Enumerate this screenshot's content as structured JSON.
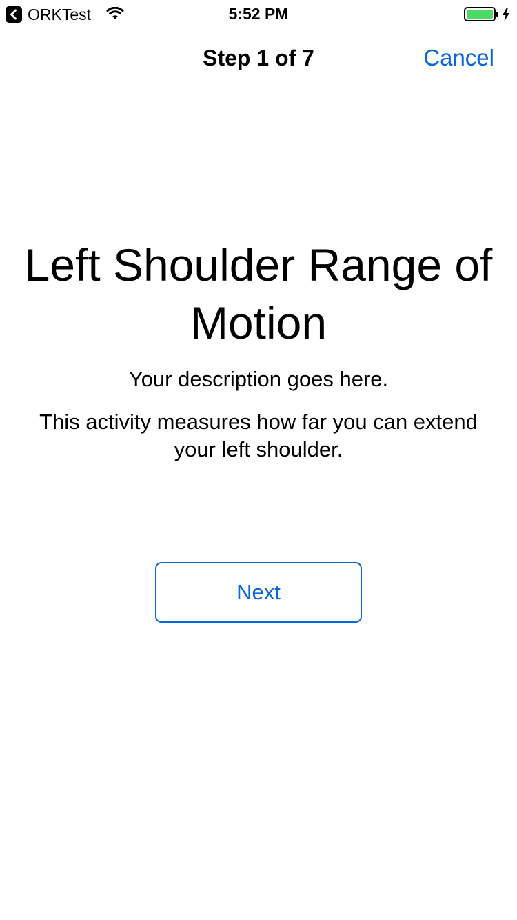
{
  "status_bar": {
    "back_app_label": "ORKTest",
    "time": "5:52 PM",
    "battery_color": "#4cd964"
  },
  "nav": {
    "title": "Step 1 of 7",
    "cancel_label": "Cancel"
  },
  "content": {
    "title": "Left Shoulder Range of Motion",
    "description": "Your description goes here.",
    "detail": "This activity measures how far you can extend your left shoulder."
  },
  "actions": {
    "next_label": "Next"
  },
  "colors": {
    "accent": "#0a66e0"
  },
  "icons": [
    "back-chevron-icon",
    "wifi-icon",
    "battery-icon",
    "charging-bolt-icon"
  ]
}
